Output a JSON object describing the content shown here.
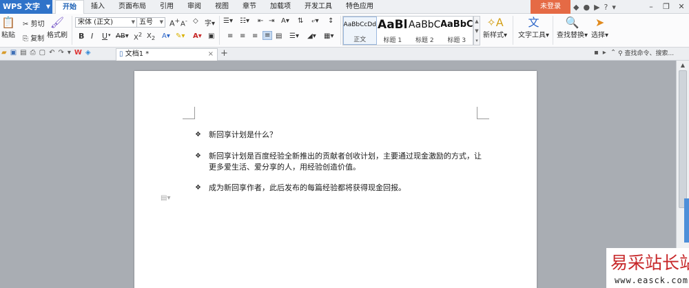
{
  "app": {
    "name": "WPS 文字"
  },
  "menu": {
    "tabs": [
      "开始",
      "插入",
      "页面布局",
      "引用",
      "审阅",
      "视图",
      "章节",
      "加载项",
      "开发工具",
      "特色应用"
    ],
    "active": "开始"
  },
  "login": "未登录",
  "ribbon": {
    "paste": "粘贴",
    "cut": "剪切",
    "copy": "复制",
    "format_painter": "格式刷",
    "font_name": "宋体 (正文)",
    "font_size": "五号",
    "bold": "B",
    "italic": "I",
    "underline": "U",
    "styles": [
      {
        "sample": "AaBbCcDd",
        "name": "正文"
      },
      {
        "sample": "AaBl",
        "name": "标题 1"
      },
      {
        "sample": "AaBbC",
        "name": "标题 2"
      },
      {
        "sample": "AaBbC",
        "name": "标题 3"
      }
    ],
    "new_style": "新样式",
    "text_tools": "文字工具",
    "find_replace": "查找替换",
    "select": "选择"
  },
  "tabbar": {
    "doc_tab": "文档1 *",
    "search_placeholder": "查找命令、搜索..."
  },
  "document": {
    "bullets": [
      "新回享计划是什么？",
      "新回享计划是百度经验全新推出的贡献者创收计划，主要通过现金激励的方式，让更多爱生活、爱分享的人，用经验创造价值。",
      "成为新回享作者，此后发布的每篇经验都将获得现金回报。"
    ]
  },
  "watermark": {
    "title": "易采站长站",
    "url": "www.easck.com"
  }
}
